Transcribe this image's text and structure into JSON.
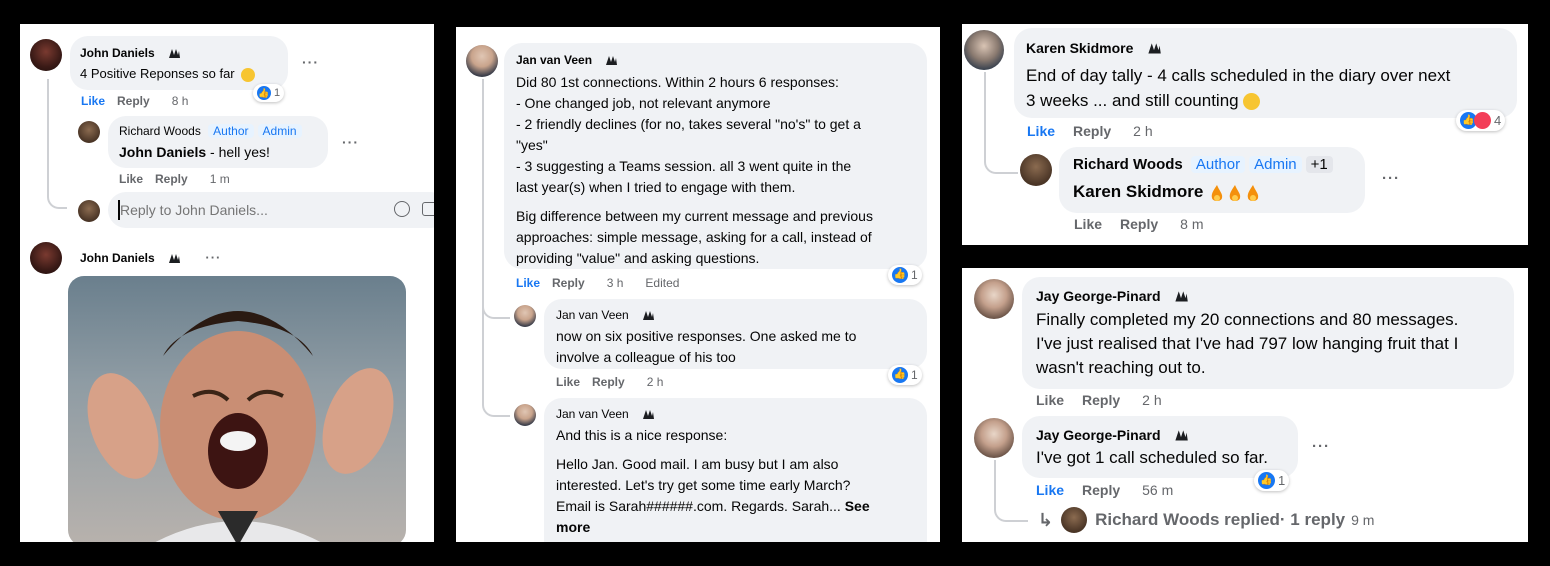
{
  "panel1": {
    "c1": {
      "author": "John Daniels",
      "text": "4 Positive Reponses so far",
      "like": "Like",
      "reply": "Reply",
      "time": "8 h",
      "reactions": "1"
    },
    "r1": {
      "author": "Richard Woods",
      "badge1": "Author",
      "badge2": "Admin",
      "mention": "John Daniels",
      "text": " - hell yes!",
      "like": "Like",
      "reply": "Reply",
      "time": "1 m"
    },
    "input": {
      "placeholder": "Reply to John Daniels..."
    },
    "c2": {
      "author": "John Daniels"
    }
  },
  "panel2": {
    "c1": {
      "author": "Jan van Veen",
      "lines": [
        "Did 80 1st connections. Within 2 hours 6 responses:",
        "- One changed job, not relevant anymore",
        "- 2 friendly declines (for no, takes several \"no's\" to get a",
        "\"yes\"",
        "- 3 suggesting a Teams session. all 3 went quite in the",
        "last year(s) when I tried to engage with them."
      ],
      "para2": [
        "Big difference between my current message and previous",
        "approaches: simple message, asking for a call, instead of",
        "providing \"value\" and asking questions."
      ],
      "like": "Like",
      "reply": "Reply",
      "time": "3 h",
      "edited": "Edited",
      "reactions": "1"
    },
    "r1": {
      "author": "Jan van Veen",
      "lines": [
        "now on six positive responses. One asked me to",
        "involve a colleague of his too"
      ],
      "like": "Like",
      "reply": "Reply",
      "time": "2 h",
      "reactions": "1"
    },
    "r2": {
      "author": "Jan van Veen",
      "intro": "And this is a nice response:",
      "lines": [
        "Hello Jan. Good mail. I am busy but I am also",
        "interested. Let's try get some time early March?",
        "Email is Sarah######.com. Regards. Sarah..."
      ],
      "see": "See",
      "more": "more"
    }
  },
  "panel3": {
    "c1": {
      "author": "Karen Skidmore",
      "lines": [
        "End of day tally - 4 calls scheduled in the diary over next",
        "3 weeks ... and still counting"
      ],
      "like": "Like",
      "reply": "Reply",
      "time": "2 h",
      "reactions": "4"
    },
    "r1": {
      "author": "Richard Woods",
      "badge1": "Author",
      "badge2": "Admin",
      "badge3": "+1",
      "mention": "Karen Skidmore",
      "like": "Like",
      "reply": "Reply",
      "time": "8 m"
    }
  },
  "panel4": {
    "c1": {
      "author": "Jay George-Pinard",
      "lines": [
        "Finally completed my 20 connections and 80 messages.",
        "I've just realised that I've had 797 low hanging fruit that I",
        "wasn't reaching out to."
      ],
      "like": "Like",
      "reply": "Reply",
      "time": "2 h"
    },
    "c2": {
      "author": "Jay George-Pinard",
      "text": "I've got 1 call scheduled so far.",
      "like": "Like",
      "reply": "Reply",
      "time": "56 m",
      "reactions": "1"
    },
    "replies": {
      "who": "Richard Woods replied",
      "count": " · 1 reply",
      "time": "9 m"
    }
  },
  "colors": {
    "accent": "#1877f2",
    "bubble": "#f0f2f5",
    "meta": "#65676b"
  }
}
